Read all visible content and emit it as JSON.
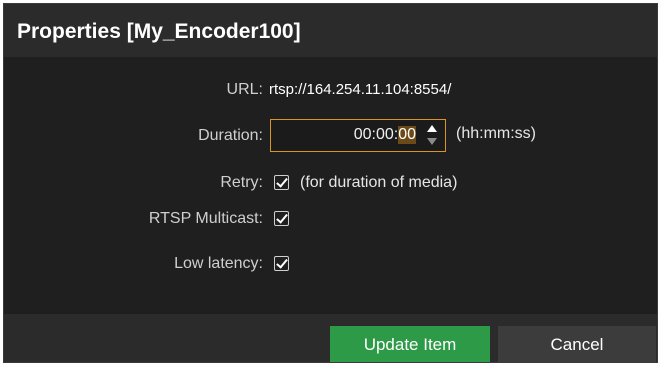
{
  "dialog": {
    "title": "Properties [My_Encoder100]"
  },
  "form": {
    "url": {
      "label": "URL:",
      "value": "rtsp://164.254.11.104:8554/"
    },
    "duration": {
      "label": "Duration:",
      "value_prefix": "00:00:",
      "value_selected": "00",
      "hint": "(hh:mm:ss)"
    },
    "retry": {
      "label": "Retry:",
      "checked": true,
      "hint": "(for duration of media)"
    },
    "rtsp_multicast": {
      "label": "RTSP Multicast:",
      "checked": true
    },
    "low_latency": {
      "label": "Low latency:",
      "checked": true
    }
  },
  "footer": {
    "update_label": "Update Item",
    "cancel_label": "Cancel"
  },
  "colors": {
    "dialog_bg": "#1f1f1f",
    "titlebar_bg": "#2b2b2b",
    "accent_border": "#d9951e",
    "primary_button": "#2d9a48",
    "secondary_button": "#3c3c3c"
  }
}
